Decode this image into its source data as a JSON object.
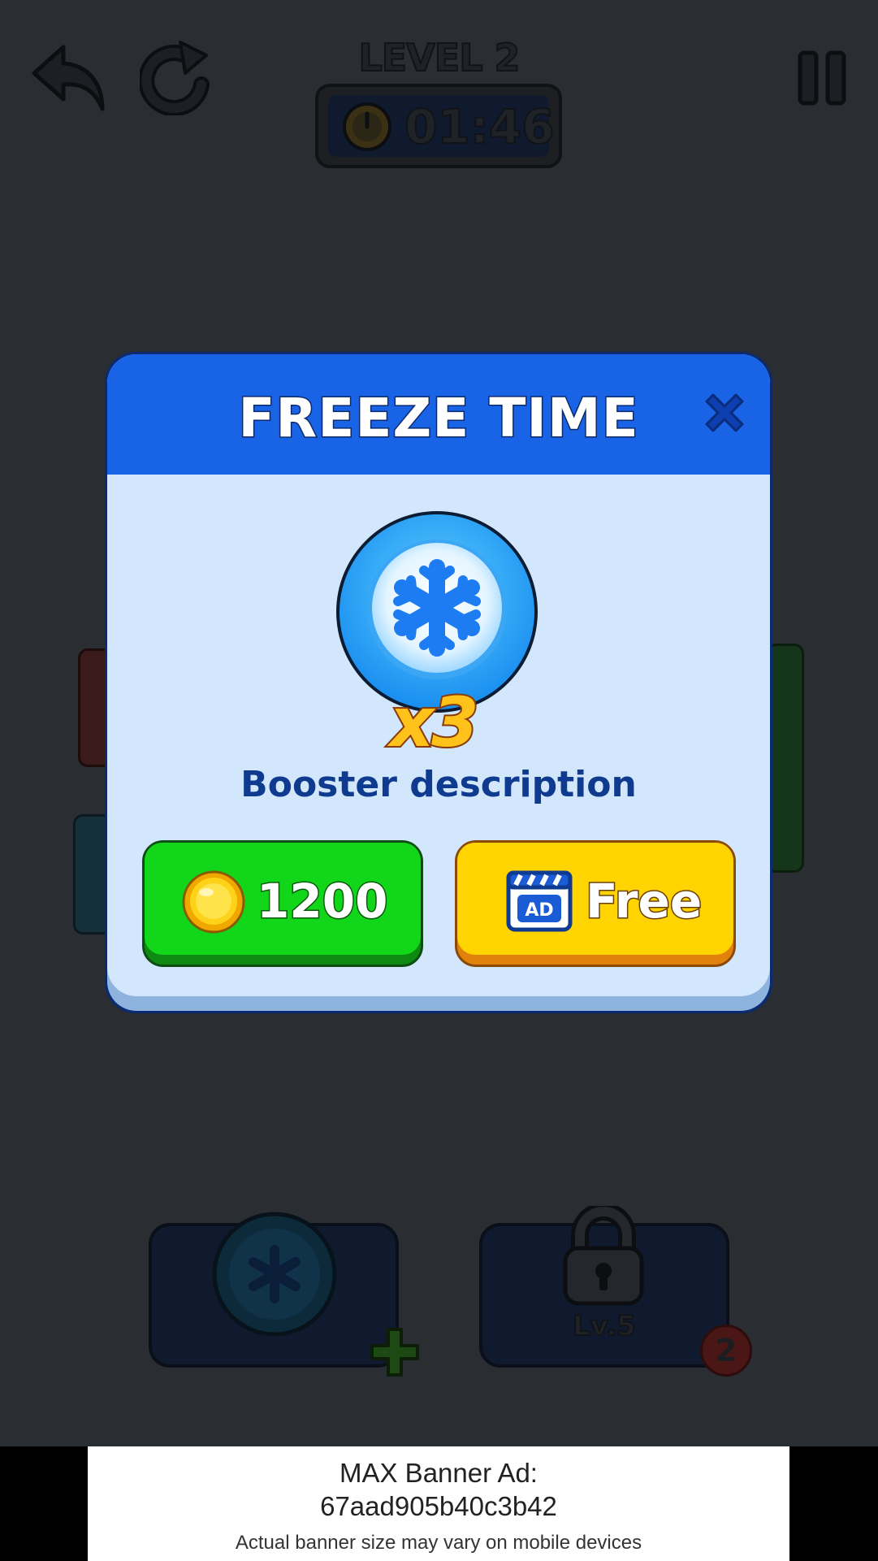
{
  "hud": {
    "level": "LEVEL 2",
    "timer": "01:46",
    "undo_icon": "undo-arrow-icon",
    "redo_icon": "restart-icon",
    "pause_icon": "pause-icon"
  },
  "booster_bar": {
    "freeze_icon": "snowflake-icon",
    "add_icon": "plus-icon",
    "locked_icon": "lock-icon",
    "locked_level": "Lv.5",
    "count": "2"
  },
  "modal": {
    "title": "FREEZE TIME",
    "close_icon": "close-icon",
    "booster_icon": "snowflake-icon",
    "quantity": "x3",
    "description": "Booster description",
    "buy_button": {
      "icon": "coin-icon",
      "label": "1200"
    },
    "free_button": {
      "icon": "ad-clapper-icon",
      "label": "Free"
    }
  },
  "banner_ad": {
    "line1": "MAX Banner Ad:",
    "line2": "67aad905b40c3b42",
    "line3": "Actual banner size may vary on mobile devices"
  },
  "colors": {
    "overlay_bg": "#2a2d31",
    "modal_header": "#1863e6",
    "modal_body": "#d2e6fc",
    "buy_button": "#12d619",
    "free_button": "#ffd400",
    "title_text": "#ffffff",
    "description_text": "#0e3a8f"
  }
}
